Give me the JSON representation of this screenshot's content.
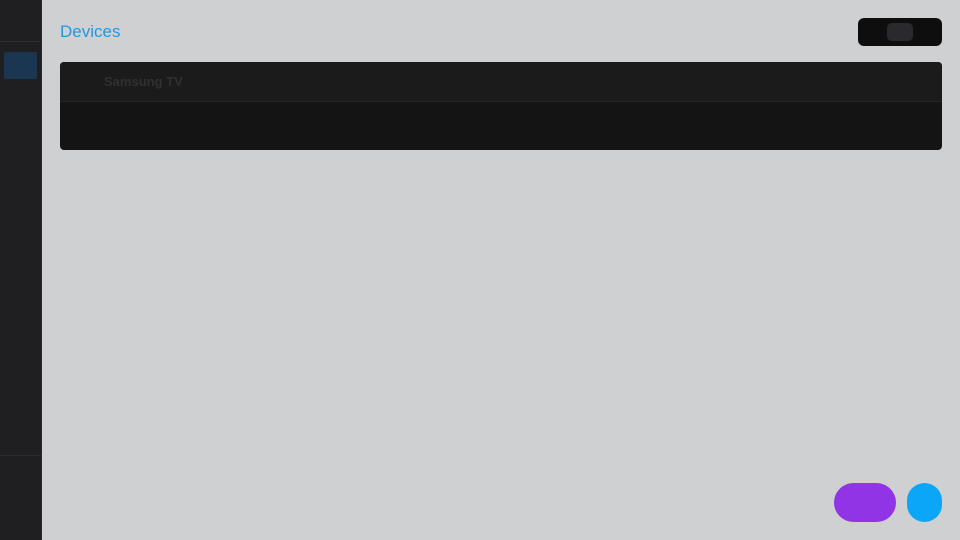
{
  "header": {
    "title": "Devices"
  },
  "devices": [
    {
      "name": "Samsung TV"
    }
  ],
  "colors": {
    "title": "#1e9ae0",
    "fab_primary": "#9134e6",
    "fab_secondary": "#0ba6f7",
    "sidebar_active": "#1b3650"
  }
}
